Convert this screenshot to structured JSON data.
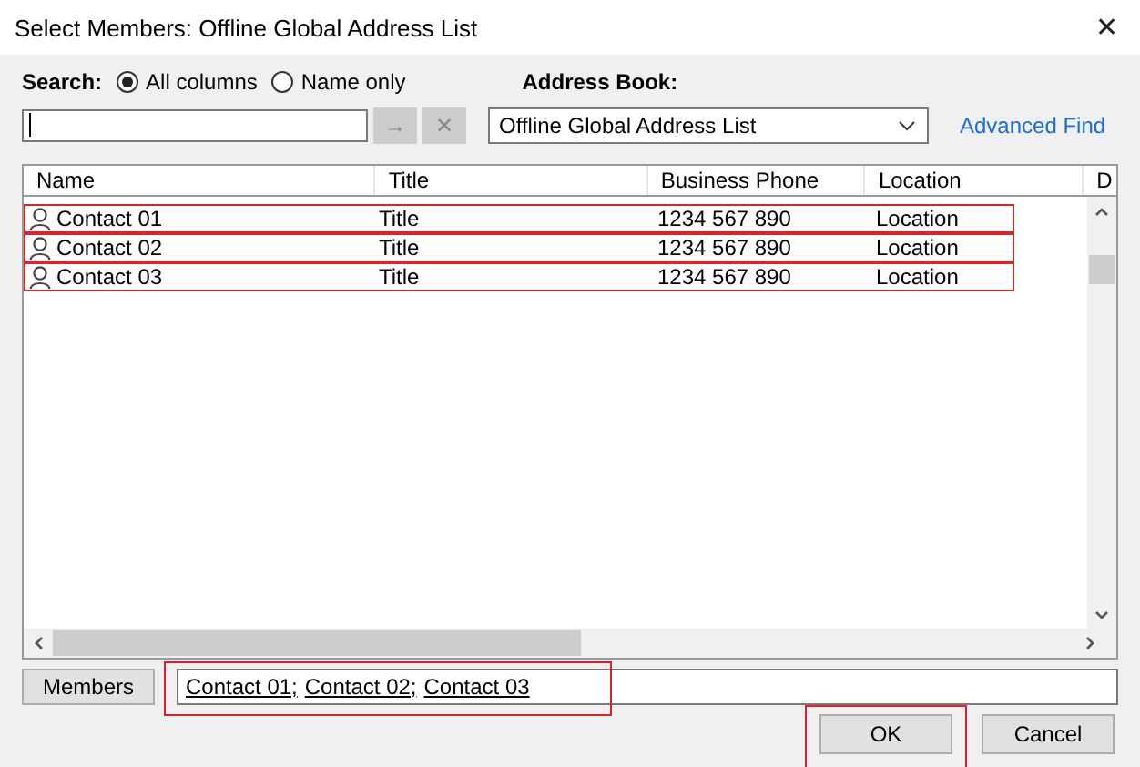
{
  "window": {
    "title": "Select Members: Offline Global Address List",
    "close": "✕"
  },
  "search": {
    "label": "Search:",
    "options": [
      {
        "label": "All columns",
        "selected": true
      },
      {
        "label": "Name only",
        "selected": false
      }
    ],
    "go": "→",
    "clear": "✕"
  },
  "address_book": {
    "label": "Address Book:",
    "value": "Offline Global Address List",
    "advanced_find": "Advanced Find"
  },
  "table": {
    "columns": [
      "Name",
      "Title",
      "Business Phone",
      "Location",
      "D"
    ],
    "rows": [
      {
        "name": "Contact 01",
        "title": "Title",
        "phone": "1234 567 890",
        "location": "Location",
        "highlighted": true
      },
      {
        "name": "Contact 02",
        "title": "Title",
        "phone": "1234 567 890",
        "location": "Location",
        "highlighted": true
      },
      {
        "name": "Contact 03",
        "title": "Title",
        "phone": "1234 567 890",
        "location": "Location",
        "highlighted": true
      }
    ]
  },
  "members": {
    "button": "Members",
    "entries": [
      "Contact 01;",
      "Contact 02;",
      "Contact 03"
    ],
    "highlighted": true
  },
  "buttons": [
    {
      "label": "OK",
      "highlighted": true
    },
    {
      "label": "Cancel",
      "highlighted": false
    }
  ]
}
